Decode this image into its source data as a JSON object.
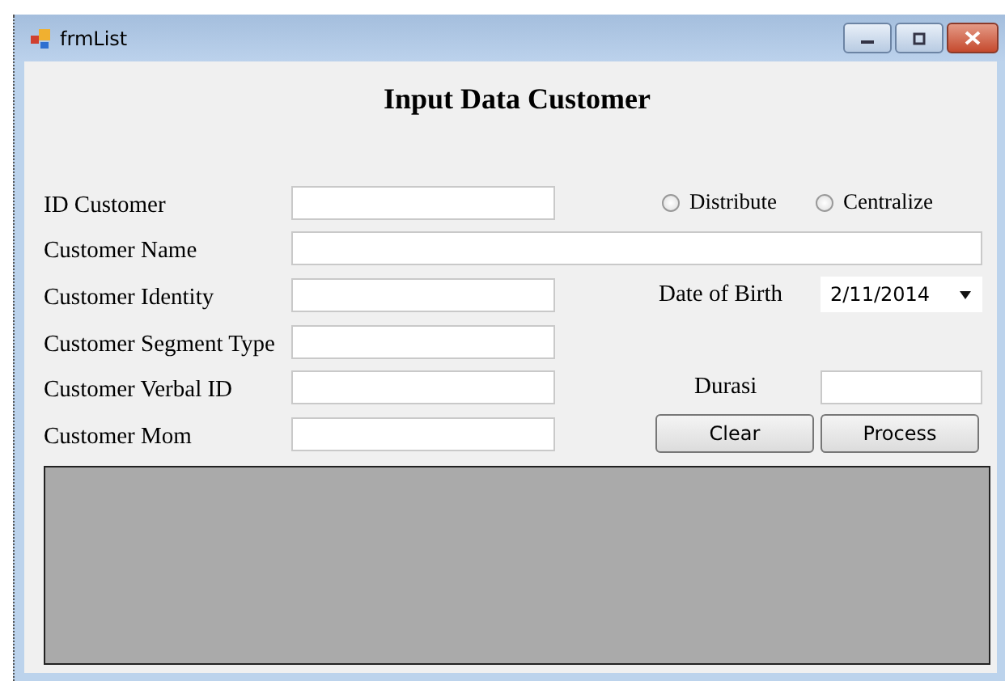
{
  "window": {
    "title": "frmList"
  },
  "heading": "Input Data Customer",
  "fields": [
    {
      "label": "ID Customer",
      "kind": "short"
    },
    {
      "label": "Customer Name",
      "kind": "wide"
    },
    {
      "label": "Customer Identity",
      "kind": "short"
    },
    {
      "label": "Customer Segment Type",
      "kind": "short"
    },
    {
      "label": "Customer Verbal ID",
      "kind": "short"
    },
    {
      "label": "Customer Mom",
      "kind": "short"
    }
  ],
  "radios": [
    {
      "label": "Distribute",
      "selected": false
    },
    {
      "label": "Centralize",
      "selected": false
    }
  ],
  "date_of_birth": {
    "label": "Date of Birth",
    "value": "2/11/2014"
  },
  "durasi": {
    "label": "Durasi"
  },
  "buttons": [
    "Clear",
    "Process"
  ]
}
